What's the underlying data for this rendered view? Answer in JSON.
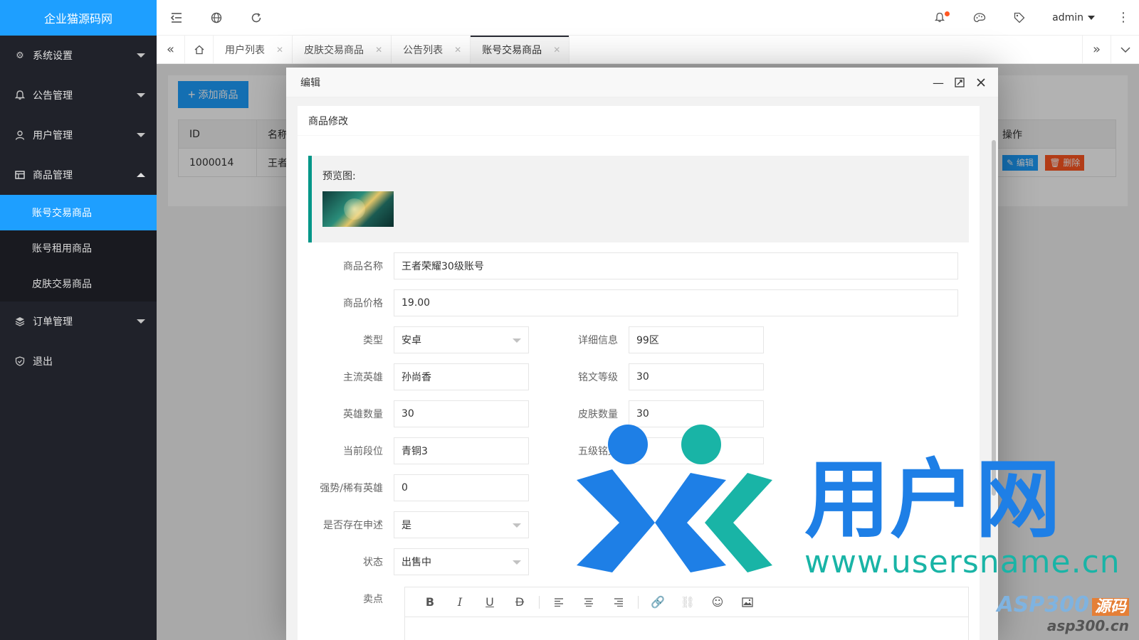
{
  "app": {
    "title": "企业猫源码网"
  },
  "sidebar": {
    "items": [
      {
        "label": "系统设置",
        "icon": "gear-icon",
        "expanded": false
      },
      {
        "label": "公告管理",
        "icon": "bell-icon",
        "expanded": false
      },
      {
        "label": "用户管理",
        "icon": "user-icon",
        "expanded": false
      },
      {
        "label": "商品管理",
        "icon": "grid-icon",
        "expanded": true
      },
      {
        "label": "订单管理",
        "icon": "layers-icon",
        "expanded": false
      },
      {
        "label": "退出",
        "icon": "shield-icon",
        "expanded": false
      }
    ],
    "subitems": [
      {
        "label": "账号交易商品",
        "active": true
      },
      {
        "label": "账号租用商品",
        "active": false
      },
      {
        "label": "皮肤交易商品",
        "active": false
      }
    ]
  },
  "header": {
    "user": "admin"
  },
  "tabs": [
    {
      "label": "用户列表",
      "active": false
    },
    {
      "label": "皮肤交易商品",
      "active": false
    },
    {
      "label": "公告列表",
      "active": false
    },
    {
      "label": "账号交易商品",
      "active": true
    }
  ],
  "content": {
    "add_button": "添加商品",
    "table": {
      "headers": [
        "ID",
        "名称",
        "操作"
      ],
      "rows": [
        {
          "id": "1000014",
          "name": "王者"
        }
      ]
    },
    "edit_label": "编辑",
    "delete_label": "删除"
  },
  "modal": {
    "title": "编辑",
    "card_title": "商品修改",
    "preview_label": "预览图:",
    "fields": {
      "name": {
        "label": "商品名称",
        "value": "王者荣耀30级账号"
      },
      "price": {
        "label": "商品价格",
        "value": "19.00"
      },
      "type": {
        "label": "类型",
        "value": "安卓"
      },
      "detail": {
        "label": "详细信息",
        "value": "99区"
      },
      "hero": {
        "label": "主流英雄",
        "value": "孙尚香"
      },
      "rune": {
        "label": "铭文等级",
        "value": "30"
      },
      "hero_count": {
        "label": "英雄数量",
        "value": "30"
      },
      "skin_count": {
        "label": "皮肤数量",
        "value": "30"
      },
      "rank": {
        "label": "当前段位",
        "value": "青铜3"
      },
      "rune5": {
        "label": "五级铭文",
        "value": ""
      },
      "strong": {
        "label": "强势/稀有英雄",
        "value": "0"
      },
      "appeal": {
        "label": "是否存在申述",
        "value": "是"
      },
      "status": {
        "label": "状态",
        "value": "出售中"
      },
      "selling": {
        "label": "卖点"
      }
    }
  },
  "watermark": {
    "title": "用户网",
    "url": "www.usersname.cn",
    "brand1": "ASP300",
    "brand1b": "源码",
    "brand2": "asp300.cn"
  },
  "colors": {
    "accent": "#1e9fff",
    "sidebar": "#20222a",
    "teal": "#009688",
    "danger": "#ff5722"
  }
}
